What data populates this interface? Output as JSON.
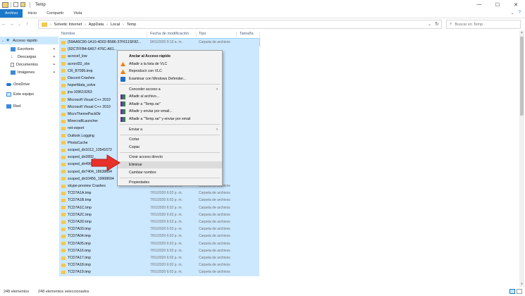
{
  "window": {
    "title": "Temp",
    "minimize": "—",
    "maximize": "☐",
    "close": "✕"
  },
  "ribbon": {
    "tabs": [
      "Archivo",
      "Inicio",
      "Compartir",
      "Vista"
    ],
    "expand_icon": "⌄",
    "help_icon": "?"
  },
  "address": {
    "breadcrumbs": [
      "Solvetic Internet",
      "AppData",
      "Local",
      "Temp"
    ],
    "separator": "›",
    "search_placeholder": "Buscar en Temp",
    "back": "←",
    "forward": "→",
    "recent": "⌄",
    "up": "↑",
    "dropdown": "⌄",
    "refresh": "↻"
  },
  "nav": {
    "items": [
      {
        "label": "Acceso rápido",
        "icon": "star-icon",
        "color": "#1e77d3"
      },
      {
        "label": "Escritorio",
        "icon": "desktop-icon",
        "color": "#3b8de0"
      },
      {
        "label": "Descargas",
        "icon": "download-icon",
        "color": "#2f80d0"
      },
      {
        "label": "Documentos",
        "icon": "document-icon",
        "color": "#8a8a8a"
      },
      {
        "label": "Imágenes",
        "icon": "image-icon",
        "color": "#3a8ad6"
      },
      {
        "label": "OneDrive",
        "icon": "cloud-icon",
        "color": "#1f74cc"
      },
      {
        "label": "Este equipo",
        "icon": "computer-icon",
        "color": "#3a8ad6"
      },
      {
        "label": "Red",
        "icon": "network-icon",
        "color": "#3a8ad6"
      }
    ],
    "pin_glyph": "📌"
  },
  "columns": {
    "name": "Nombre",
    "date": "Fecha de modificación",
    "type": "Tipo",
    "size": "Tamaño",
    "sort_arrow": "^"
  },
  "files": [
    {
      "name": "{59AA5C80-1A10-4D02-B586-37F611SF82...",
      "date": "9/01/2020 9:10 a. m.",
      "type": "Carpeta de archivos",
      "kind": "folder"
    },
    {
      "name": "{92C7FFB4-6A57-476C-A61...",
      "date": "",
      "type": "",
      "kind": "folder"
    },
    {
      "name": "acrocef_low",
      "date": "",
      "type": "",
      "kind": "folder"
    },
    {
      "name": "acrord32_sbx",
      "date": "",
      "type": "",
      "kind": "folder"
    },
    {
      "name": "CR_B7095.tmp",
      "date": "",
      "type": "",
      "kind": "folder"
    },
    {
      "name": "Discord Crashes",
      "date": "",
      "type": "",
      "kind": "folder"
    },
    {
      "name": "hsperfdata_solve",
      "date": "",
      "type": "",
      "kind": "folder"
    },
    {
      "name": "jna-109619263",
      "date": "",
      "type": "",
      "kind": "folder"
    },
    {
      "name": "Microsoft Visual C++ 2010",
      "date": "",
      "type": "",
      "kind": "folder"
    },
    {
      "name": "Microsoft Visual C++ 2010",
      "date": "",
      "type": "",
      "kind": "folder"
    },
    {
      "name": "MicroThemePackDir",
      "date": "",
      "type": "",
      "kind": "folder"
    },
    {
      "name": "MinecraftLauncher",
      "date": "",
      "type": "",
      "kind": "folder"
    },
    {
      "name": "net-export",
      "date": "",
      "type": "",
      "kind": "folder"
    },
    {
      "name": "Outlook Logging",
      "date": "",
      "type": "",
      "kind": "folder"
    },
    {
      "name": "PhotoCache",
      "date": "",
      "type": "",
      "kind": "folder"
    },
    {
      "name": "scoped_dir1012_13541672",
      "date": "",
      "type": "",
      "kind": "folder"
    },
    {
      "name": "scoped_dir2892_",
      "date": "",
      "type": "",
      "kind": "folder"
    },
    {
      "name": "scoped_dir4960_",
      "date": "",
      "type": "",
      "kind": "folder"
    },
    {
      "name": "scoped_dir7404_18638694",
      "date": "",
      "type": "",
      "kind": "folder"
    },
    {
      "name": "scoped_dir10456_19908694",
      "date": "",
      "type": "",
      "kind": "folder"
    },
    {
      "name": "skype-preview Crashes",
      "date": "9/01/2020 9:10 a. m.",
      "type": "Carpeta de archivos",
      "kind": "folder"
    },
    {
      "name": "TCD7A1A.tmp",
      "date": "7/01/2020 6:02 p. m.",
      "type": "Carpeta de archivos",
      "kind": "folder"
    },
    {
      "name": "TCD7A1B.tmp",
      "date": "7/01/2020 6:02 p. m.",
      "type": "Carpeta de archivos",
      "kind": "folder"
    },
    {
      "name": "TCD7A1C.tmp",
      "date": "7/01/2020 6:02 p. m.",
      "type": "Carpeta de archivos",
      "kind": "folder"
    },
    {
      "name": "TCD7A2C.tmp",
      "date": "7/01/2020 6:02 p. m.",
      "type": "Carpeta de archivos",
      "kind": "folder"
    },
    {
      "name": "TCD7A2D.tmp",
      "date": "7/01/2020 6:02 p. m.",
      "type": "Carpeta de archivos",
      "kind": "folder"
    },
    {
      "name": "TCD7A03.tmp",
      "date": "7/01/2020 6:02 p. m.",
      "type": "Carpeta de archivos",
      "kind": "folder"
    },
    {
      "name": "TCD7A04.tmp",
      "date": "7/01/2020 6:02 p. m.",
      "type": "Carpeta de archivos",
      "kind": "folder"
    },
    {
      "name": "TCD7A05.tmp",
      "date": "7/01/2020 6:02 p. m.",
      "type": "Carpeta de archivos",
      "kind": "folder"
    },
    {
      "name": "TCD7A16.tmp",
      "date": "7/01/2020 6:02 p. m.",
      "type": "Carpeta de archivos",
      "kind": "folder"
    },
    {
      "name": "TCD7A17.tmp",
      "date": "7/01/2020 6:02 p. m.",
      "type": "Carpeta de archivos",
      "kind": "folder"
    },
    {
      "name": "TCD7A18.tmp",
      "date": "7/01/2020 6:02 p. m.",
      "type": "Carpeta de archivos",
      "kind": "folder"
    },
    {
      "name": "TCD7A19.tmp",
      "date": "7/01/2020 6:02 p. m.",
      "type": "Carpeta de archivos",
      "kind": "folder"
    }
  ],
  "context_menu": {
    "items": [
      {
        "label": "Anclar al Acceso rápido",
        "bold": true,
        "icon": ""
      },
      {
        "label": "Añadir a la lista de VLC",
        "icon": "vlc-icon"
      },
      {
        "label": "Reproducir con VLC",
        "icon": "vlc-icon"
      },
      {
        "label": "Examinar con Windows Defender...",
        "icon": "defender-icon"
      },
      {
        "sep": true
      },
      {
        "label": "Conceder acceso a",
        "submenu": true,
        "icon": ""
      },
      {
        "label": "Añadir al archivo...",
        "icon": "winrar-icon"
      },
      {
        "label": "Añadir a \"Temp.rar\"",
        "icon": "winrar-icon"
      },
      {
        "label": "Añadir y enviar por email...",
        "icon": "winrar-icon"
      },
      {
        "label": "Añadir a \"Temp.rar\" y enviar por email",
        "icon": "winrar-icon"
      },
      {
        "sep": true
      },
      {
        "label": "Enviar a",
        "submenu": true,
        "icon": ""
      },
      {
        "sep": true
      },
      {
        "label": "Cortar",
        "icon": ""
      },
      {
        "label": "Copiar",
        "icon": ""
      },
      {
        "sep": true
      },
      {
        "label": "Crear acceso directo",
        "icon": ""
      },
      {
        "label": "Eliminar",
        "icon": "",
        "hover": true
      },
      {
        "label": "Cambiar nombre",
        "icon": ""
      },
      {
        "sep": true
      },
      {
        "label": "Propiedades",
        "icon": ""
      }
    ],
    "submenu_arrow": "›"
  },
  "status": {
    "count": "248 elementos",
    "selected": "248 elementos seleccionados"
  },
  "colors": {
    "selection": "#cce8ff",
    "accent": "#1979ca",
    "arrow": "#e8312a"
  }
}
